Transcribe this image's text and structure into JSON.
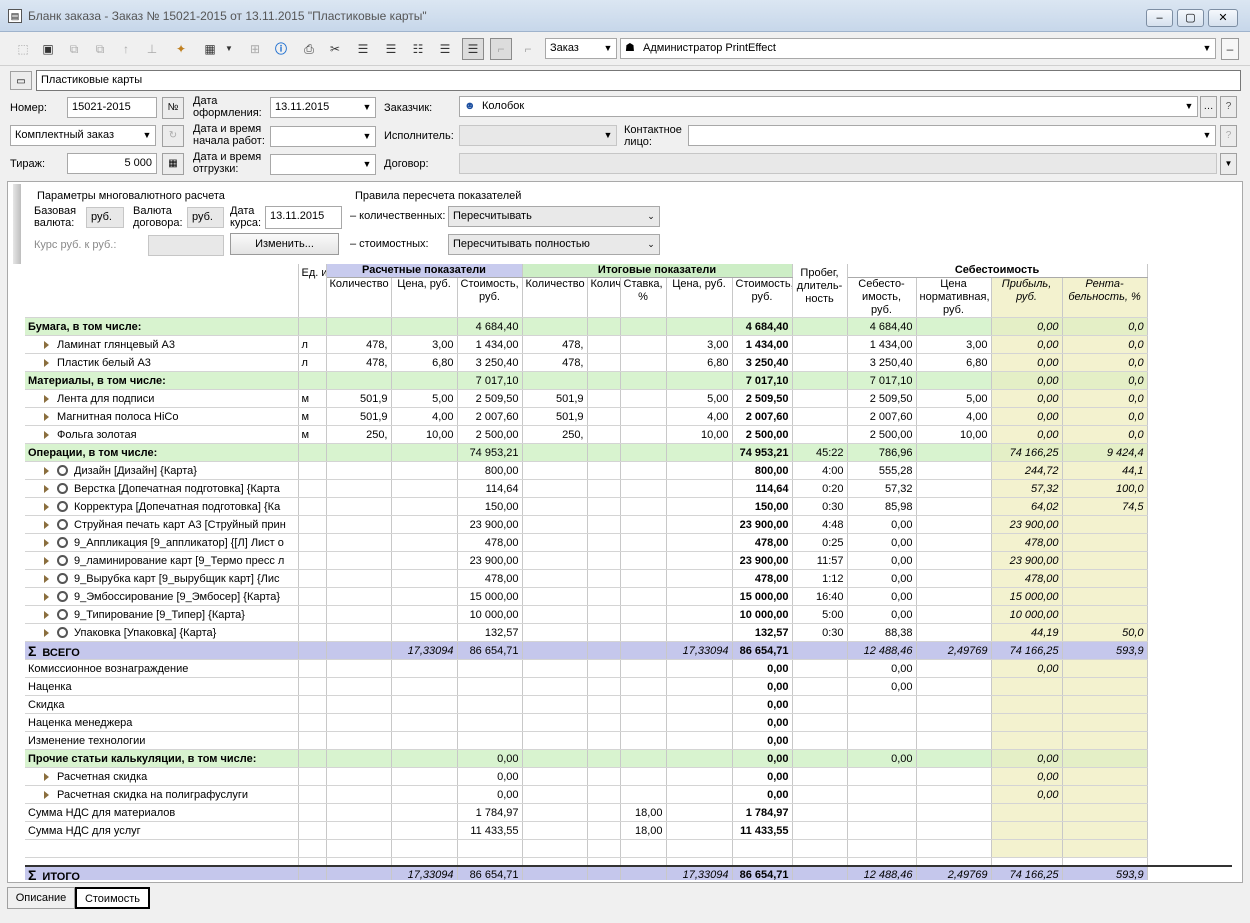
{
  "window": {
    "title": "Бланк заказа - Заказ № 15021-2015 от 13.11.2015 \"Пластиковые карты\""
  },
  "toolbar": {
    "doc_type": "Заказ",
    "user": "Администратор PrintEffect"
  },
  "form": {
    "name": "Пластиковые карты",
    "number_label": "Номер:",
    "number": "15021-2015",
    "date_label": "Дата оформления:",
    "date": "13.11.2015",
    "customer_label": "Заказчик:",
    "customer": "Колобок",
    "order_type": "Комплектный заказ",
    "start_label": "Дата и время начала работ:",
    "executor_label": "Исполнитель:",
    "contact_label": "Контактное лицо:",
    "run_label": "Тираж:",
    "run": "5 000",
    "ship_label": "Дата и время отгрузки:",
    "contract_label": "Договор:"
  },
  "params": {
    "group_title": "Параметры многовалютного расчета",
    "base_cur_label": "Базовая валюта:",
    "base_cur": "руб.",
    "contract_cur_label": "Валюта договора:",
    "contract_cur": "руб.",
    "rate_date_label": "Дата курса:",
    "rate_date": "13.11.2015",
    "rate_label": "Курс руб. к руб.:",
    "change_button": "Изменить...",
    "rules_title": "Правила пересчета показателей",
    "quant_label": "– количественных:",
    "quant_value": "Пересчитывать",
    "cost_label": "– стоимостных:",
    "cost_value": "Пересчитывать полностью"
  },
  "grid": {
    "group_headers": {
      "calc": "Расчетные показатели",
      "final": "Итоговые показатели",
      "mileage": "Пробег, длитель-ность",
      "cost": "Себестоимость"
    },
    "columns": [
      "Ед. изм.",
      "Количество",
      "Цена, руб.",
      "Стоимость, руб.",
      "Количество",
      "Количество заказа",
      "Ставка, %",
      "Цена, руб.",
      "Стоимость, руб.",
      "Себесто-имость, руб.",
      "Цена нормативная, руб.",
      "Прибыль, руб.",
      "Рента-бельность, %"
    ],
    "rows": [
      {
        "t": "grp",
        "name": "Бумага, в том числе:",
        "c": [
          "",
          "",
          "",
          "4 684,40",
          "",
          "",
          "",
          "",
          "4 684,40",
          "",
          "4 684,40",
          "",
          "0,00",
          "0,0"
        ]
      },
      {
        "t": "sub",
        "name": "Ламинат глянцевый А3",
        "c": [
          "л",
          "478,",
          "3,00",
          "1 434,00",
          "478,",
          "",
          "",
          "3,00",
          "1 434,00",
          "",
          "1 434,00",
          "3,00",
          "0,00",
          "0,0"
        ]
      },
      {
        "t": "sub",
        "name": "Пластик белый А3",
        "c": [
          "л",
          "478,",
          "6,80",
          "3 250,40",
          "478,",
          "",
          "",
          "6,80",
          "3 250,40",
          "",
          "3 250,40",
          "6,80",
          "0,00",
          "0,0"
        ]
      },
      {
        "t": "grp",
        "name": "Материалы, в том числе:",
        "c": [
          "",
          "",
          "",
          "7 017,10",
          "",
          "",
          "",
          "",
          "7 017,10",
          "",
          "7 017,10",
          "",
          "0,00",
          "0,0"
        ]
      },
      {
        "t": "sub",
        "name": "Лента для подписи",
        "c": [
          "м",
          "501,9",
          "5,00",
          "2 509,50",
          "501,9",
          "",
          "",
          "5,00",
          "2 509,50",
          "",
          "2 509,50",
          "5,00",
          "0,00",
          "0,0"
        ]
      },
      {
        "t": "sub",
        "name": "Магнитная полоса HiCo",
        "c": [
          "м",
          "501,9",
          "4,00",
          "2 007,60",
          "501,9",
          "",
          "",
          "4,00",
          "2 007,60",
          "",
          "2 007,60",
          "4,00",
          "0,00",
          "0,0"
        ]
      },
      {
        "t": "sub",
        "name": "Фольга золотая",
        "c": [
          "м",
          "250,",
          "10,00",
          "2 500,00",
          "250,",
          "",
          "",
          "10,00",
          "2 500,00",
          "",
          "2 500,00",
          "10,00",
          "0,00",
          "0,0"
        ]
      },
      {
        "t": "grp",
        "name": "Операции, в том числе:",
        "c": [
          "",
          "",
          "",
          "74 953,21",
          "",
          "",
          "",
          "",
          "74 953,21",
          "45:22",
          "786,96",
          "",
          "74 166,25",
          "9 424,4"
        ]
      },
      {
        "t": "op",
        "name": "Дизайн [Дизайн] {Карта}",
        "c": [
          "",
          "",
          "",
          "800,00",
          "",
          "",
          "",
          "",
          "800,00",
          "4:00",
          "555,28",
          "",
          "244,72",
          "44,1"
        ]
      },
      {
        "t": "op",
        "name": "Верстка [Допечатная подготовка] {Карта",
        "c": [
          "",
          "",
          "",
          "114,64",
          "",
          "",
          "",
          "",
          "114,64",
          "0:20",
          "57,32",
          "",
          "57,32",
          "100,0"
        ]
      },
      {
        "t": "op",
        "name": "Корректура [Допечатная подготовка] {Ка",
        "c": [
          "",
          "",
          "",
          "150,00",
          "",
          "",
          "",
          "",
          "150,00",
          "0:30",
          "85,98",
          "",
          "64,02",
          "74,5"
        ]
      },
      {
        "t": "op",
        "name": "Струйная печать карт А3 [Струйный прин",
        "c": [
          "",
          "",
          "",
          "23 900,00",
          "",
          "",
          "",
          "",
          "23 900,00",
          "4:48",
          "0,00",
          "",
          "23 900,00",
          ""
        ]
      },
      {
        "t": "op",
        "name": "9_Аппликация [9_аппликатор] {[Л] Лист о",
        "c": [
          "",
          "",
          "",
          "478,00",
          "",
          "",
          "",
          "",
          "478,00",
          "0:25",
          "0,00",
          "",
          "478,00",
          ""
        ]
      },
      {
        "t": "op",
        "name": "9_ламинирование карт [9_Термо пресс л",
        "c": [
          "",
          "",
          "",
          "23 900,00",
          "",
          "",
          "",
          "",
          "23 900,00",
          "11:57",
          "0,00",
          "",
          "23 900,00",
          ""
        ]
      },
      {
        "t": "op",
        "name": "9_Вырубка карт [9_вырубщик карт] {Лис",
        "c": [
          "",
          "",
          "",
          "478,00",
          "",
          "",
          "",
          "",
          "478,00",
          "1:12",
          "0,00",
          "",
          "478,00",
          ""
        ]
      },
      {
        "t": "op",
        "name": "9_Эмбоссирование [9_Эмбосер] {Карта}",
        "c": [
          "",
          "",
          "",
          "15 000,00",
          "",
          "",
          "",
          "",
          "15 000,00",
          "16:40",
          "0,00",
          "",
          "15 000,00",
          ""
        ]
      },
      {
        "t": "op",
        "name": "9_Типирование [9_Типер] {Карта}",
        "c": [
          "",
          "",
          "",
          "10 000,00",
          "",
          "",
          "",
          "",
          "10 000,00",
          "5:00",
          "0,00",
          "",
          "10 000,00",
          ""
        ]
      },
      {
        "t": "op",
        "name": "Упаковка [Упаковка] {Карта}",
        "c": [
          "",
          "",
          "",
          "132,57",
          "",
          "",
          "",
          "",
          "132,57",
          "0:30",
          "88,38",
          "",
          "44,19",
          "50,0"
        ]
      },
      {
        "t": "tot",
        "name": "ВСЕГО",
        "c": [
          "",
          "",
          "17,33094",
          "86 654,71",
          "",
          "",
          "",
          "17,33094",
          "86 654,71",
          "",
          "12 488,46",
          "2,49769",
          "74 166,25",
          "593,9"
        ]
      },
      {
        "t": "plain",
        "name": "Комиссионное вознаграждение",
        "c": [
          "",
          "",
          "",
          "",
          "",
          "",
          "",
          "",
          "0,00",
          "",
          "0,00",
          "",
          "0,00",
          ""
        ]
      },
      {
        "t": "plain",
        "name": "Наценка",
        "c": [
          "",
          "",
          "",
          "",
          "",
          "",
          "",
          "",
          "0,00",
          "",
          "0,00",
          "",
          "",
          ""
        ]
      },
      {
        "t": "plain",
        "name": "Скидка",
        "c": [
          "",
          "",
          "",
          "",
          "",
          "",
          "",
          "",
          "0,00",
          "",
          "",
          "",
          "",
          ""
        ]
      },
      {
        "t": "plain",
        "name": "Наценка менеджера",
        "c": [
          "",
          "",
          "",
          "",
          "",
          "",
          "",
          "",
          "0,00",
          "",
          "",
          "",
          "",
          ""
        ]
      },
      {
        "t": "plain",
        "name": "Изменение технологии",
        "c": [
          "",
          "",
          "",
          "",
          "",
          "",
          "",
          "",
          "0,00",
          "",
          "",
          "",
          "",
          ""
        ]
      },
      {
        "t": "grp",
        "name": "Прочие статьи калькуляции, в том числе:",
        "c": [
          "",
          "",
          "",
          "0,00",
          "",
          "",
          "",
          "",
          "0,00",
          "",
          "0,00",
          "",
          "0,00",
          ""
        ]
      },
      {
        "t": "sub",
        "name": "Расчетная скидка",
        "c": [
          "",
          "",
          "",
          "0,00",
          "",
          "",
          "",
          "",
          "0,00",
          "",
          "",
          "",
          "0,00",
          ""
        ]
      },
      {
        "t": "sub",
        "name": "Расчетная скидка на полиграфуслуги",
        "c": [
          "",
          "",
          "",
          "0,00",
          "",
          "",
          "",
          "",
          "0,00",
          "",
          "",
          "",
          "0,00",
          ""
        ]
      },
      {
        "t": "plain",
        "name": "Сумма НДС для материалов",
        "c": [
          "",
          "",
          "",
          "1 784,97",
          "",
          "",
          "18,00",
          "",
          "1 784,97",
          "",
          "",
          "",
          "",
          ""
        ]
      },
      {
        "t": "plain",
        "name": "Сумма НДС для услуг",
        "c": [
          "",
          "",
          "",
          "11 433,55",
          "",
          "",
          "18,00",
          "",
          "11 433,55",
          "",
          "",
          "",
          "",
          ""
        ]
      },
      {
        "t": "plain",
        "name": "",
        "c": [
          "",
          "",
          "",
          "",
          "",
          "",
          "",
          "",
          "",
          "",
          "",
          "",
          "",
          ""
        ]
      }
    ],
    "total": {
      "name": "ИТОГО",
      "c": [
        "",
        "",
        "17,33094",
        "86 654,71",
        "",
        "",
        "",
        "17,33094",
        "86 654,71",
        "",
        "12 488,46",
        "2,49769",
        "74 166,25",
        "593,9"
      ]
    }
  },
  "tabs": [
    "Описание",
    "Стоимость"
  ]
}
